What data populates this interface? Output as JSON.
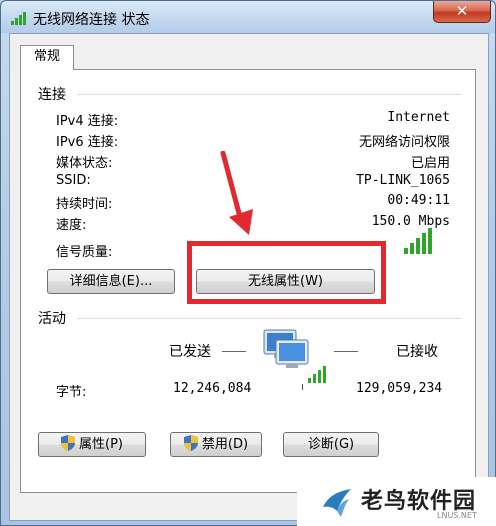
{
  "window": {
    "title": "无线网络连接 状态",
    "close_label": "✕"
  },
  "tabs": [
    {
      "label": "常规"
    }
  ],
  "connection": {
    "title": "连接",
    "rows": [
      {
        "label": "IPv4 连接:",
        "value": "Internet"
      },
      {
        "label": "IPv6 连接:",
        "value": "无网络访问权限"
      },
      {
        "label": "媒体状态:",
        "value": "已启用"
      },
      {
        "label": "SSID:",
        "value": "TP-LINK_1065"
      },
      {
        "label": "持续时间:",
        "value": "00:49:11"
      },
      {
        "label": "速度:",
        "value": "150.0 Mbps"
      },
      {
        "label": "信号质量:",
        "value": ""
      }
    ],
    "details_button": "详细信息(E)...",
    "wireless_props_button": "无线属性(W)"
  },
  "activity": {
    "title": "活动",
    "sent_label": "已发送",
    "received_label": "已接收",
    "bytes_label": "字节:",
    "bytes_sent": "12,246,084",
    "bytes_received": "129,059,234"
  },
  "buttons": {
    "properties": "属性(P)",
    "disable": "禁用(D)",
    "diagnose": "诊断(G)"
  },
  "watermark": {
    "text": "老鸟软件园",
    "sub": "LNUS.NET"
  },
  "colors": {
    "highlight_box": "#e02a2f",
    "signal_green": "#2fa52a"
  }
}
